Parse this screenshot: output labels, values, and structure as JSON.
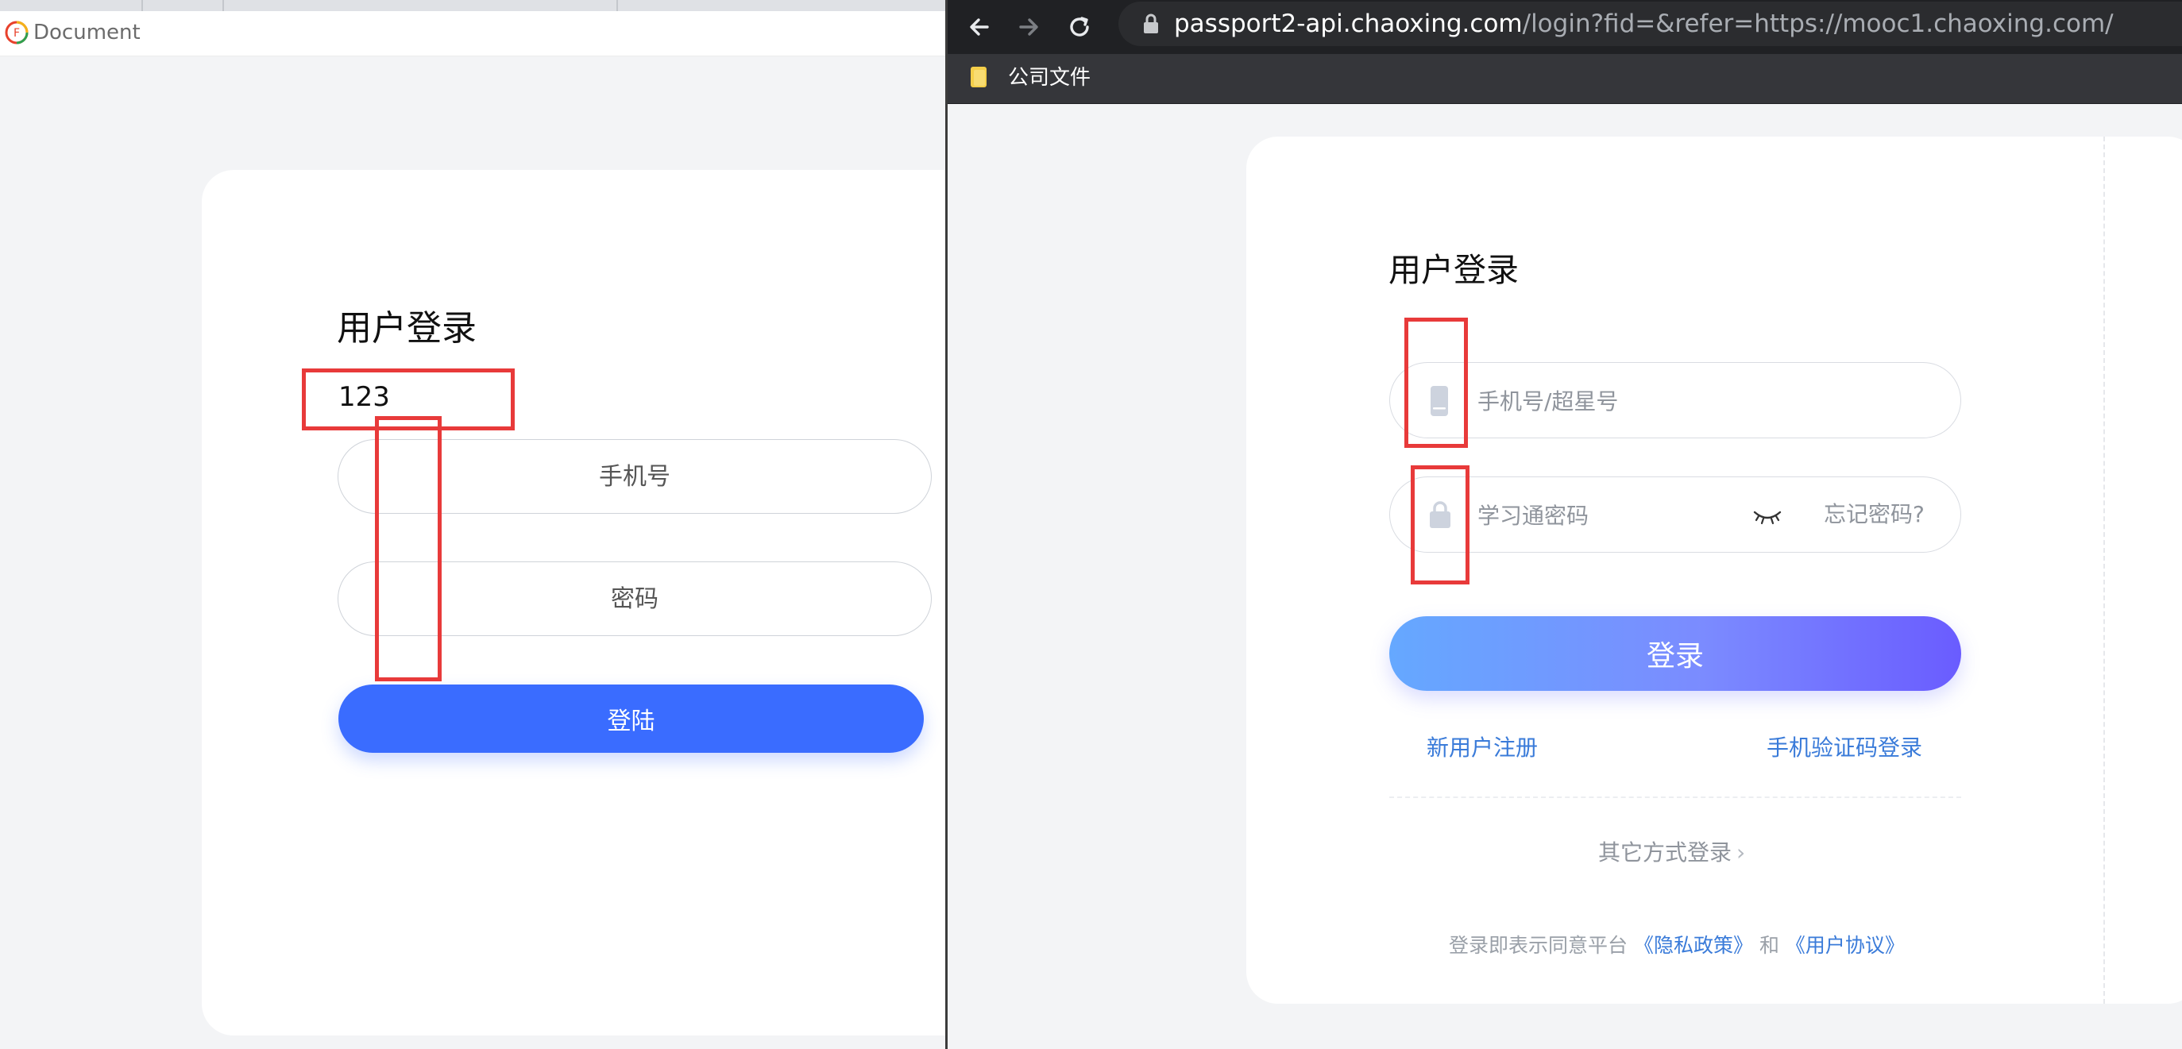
{
  "left_window": {
    "tab_title": "Document",
    "login_title": "用户登录",
    "username_text": "123",
    "phone_placeholder": "手机号",
    "password_placeholder": "密码",
    "login_button": "登陆",
    "accent_color": "#3a6cff"
  },
  "right_window": {
    "url_host": "passport2-api.chaoxing.com",
    "url_rest": "/login?fid=&refer=https://mooc1.chaoxing.com/",
    "bookmark_label": "公司文件",
    "login_title": "用户登录",
    "account_placeholder": "手机号/超星号",
    "password_placeholder": "学习通密码",
    "forgot_password": "忘记密码?",
    "login_button": "登录",
    "register_link": "新用户注册",
    "sms_login_link": "手机验证码登录",
    "other_login": "其它方式登录",
    "agreement_prefix": "登录即表示同意平台",
    "privacy_policy": "《隐私政策》",
    "agreement_and": "和",
    "user_agreement": "《用户协议》",
    "link_color": "#3a7bd9"
  },
  "icons": {
    "left_logo": "browser-logo-icon",
    "back": "arrow-left-icon",
    "forward": "arrow-right-icon",
    "reload": "reload-icon",
    "lock": "lock-icon",
    "bookmark_folder": "folder-icon",
    "phone": "phone-icon",
    "padlock": "padlock-icon",
    "eye": "eye-closed-icon",
    "chevron": "chevron-right-icon"
  },
  "annotations": {
    "box_color": "#e83a3a"
  }
}
